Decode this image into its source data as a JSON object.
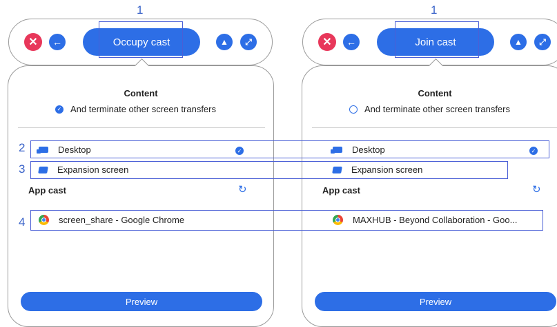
{
  "panels": [
    {
      "main_button": "Occupy cast",
      "content_title": "Content",
      "terminate_text": "And terminate other screen transfers",
      "terminate_checked": true,
      "desktop_label": "Desktop",
      "expansion_label": "Expansion screen",
      "app_cast_title": "App cast",
      "app_item": "screen_share - Google Chrome",
      "preview_label": "Preview"
    },
    {
      "main_button": "Join cast",
      "content_title": "Content",
      "terminate_text": "And terminate other screen transfers",
      "terminate_checked": false,
      "desktop_label": "Desktop",
      "expansion_label": "Expansion screen",
      "app_cast_title": "App cast",
      "app_item": "MAXHUB - Beyond Collaboration - Goo...",
      "preview_label": "Preview"
    }
  ],
  "annotations": [
    "1",
    "1",
    "2",
    "3",
    "4"
  ],
  "colors": {
    "accent": "#2d6ee6",
    "close": "#e8375a",
    "annotation": "#4a5fd6"
  }
}
